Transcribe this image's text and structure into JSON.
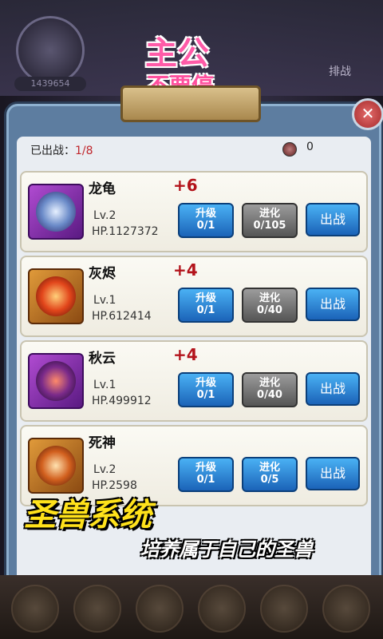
{
  "header": {
    "score": "1439654",
    "top_right_label": "排战",
    "logo_line1": "主公",
    "logo_line2": "不要停"
  },
  "panel": {
    "deployed_label": "已出战：",
    "deployed_value": "1/8",
    "coin_value": "0",
    "close_icon": "close-icon"
  },
  "beasts": [
    {
      "name": "龙龟",
      "bonus": "+6",
      "level": "Lv.2",
      "hp": "HP.1127372",
      "frame": "purple",
      "upgrade_label": "升级",
      "upgrade_count": "0/1",
      "evolve_label": "进化",
      "evolve_count": "0/105",
      "deploy_label": "出战"
    },
    {
      "name": "灰烬",
      "bonus": "+4",
      "level": "Lv.1",
      "hp": "HP.612414",
      "frame": "orange",
      "upgrade_label": "升级",
      "upgrade_count": "0/1",
      "evolve_label": "进化",
      "evolve_count": "0/40",
      "deploy_label": "出战"
    },
    {
      "name": "秋云",
      "bonus": "+4",
      "level": "Lv.1",
      "hp": "HP.499912",
      "frame": "purple",
      "upgrade_label": "升级",
      "upgrade_count": "0/1",
      "evolve_label": "进化",
      "evolve_count": "0/40",
      "deploy_label": "出战"
    },
    {
      "name": "死神",
      "bonus": "",
      "level": "Lv.2",
      "hp": "HP.2598",
      "frame": "orange",
      "upgrade_label": "升级",
      "upgrade_count": "0/1",
      "evolve_label": "进化",
      "evolve_count": "0/5",
      "deploy_label": "出战"
    }
  ],
  "promo": {
    "title": "圣兽系统",
    "subtitle": "培养属于自己的圣兽"
  },
  "colors": {
    "accent_red": "#b3131b",
    "button_blue": "#1b63b8",
    "button_gray": "#555555",
    "banner_yellow": "#ffe21b"
  }
}
